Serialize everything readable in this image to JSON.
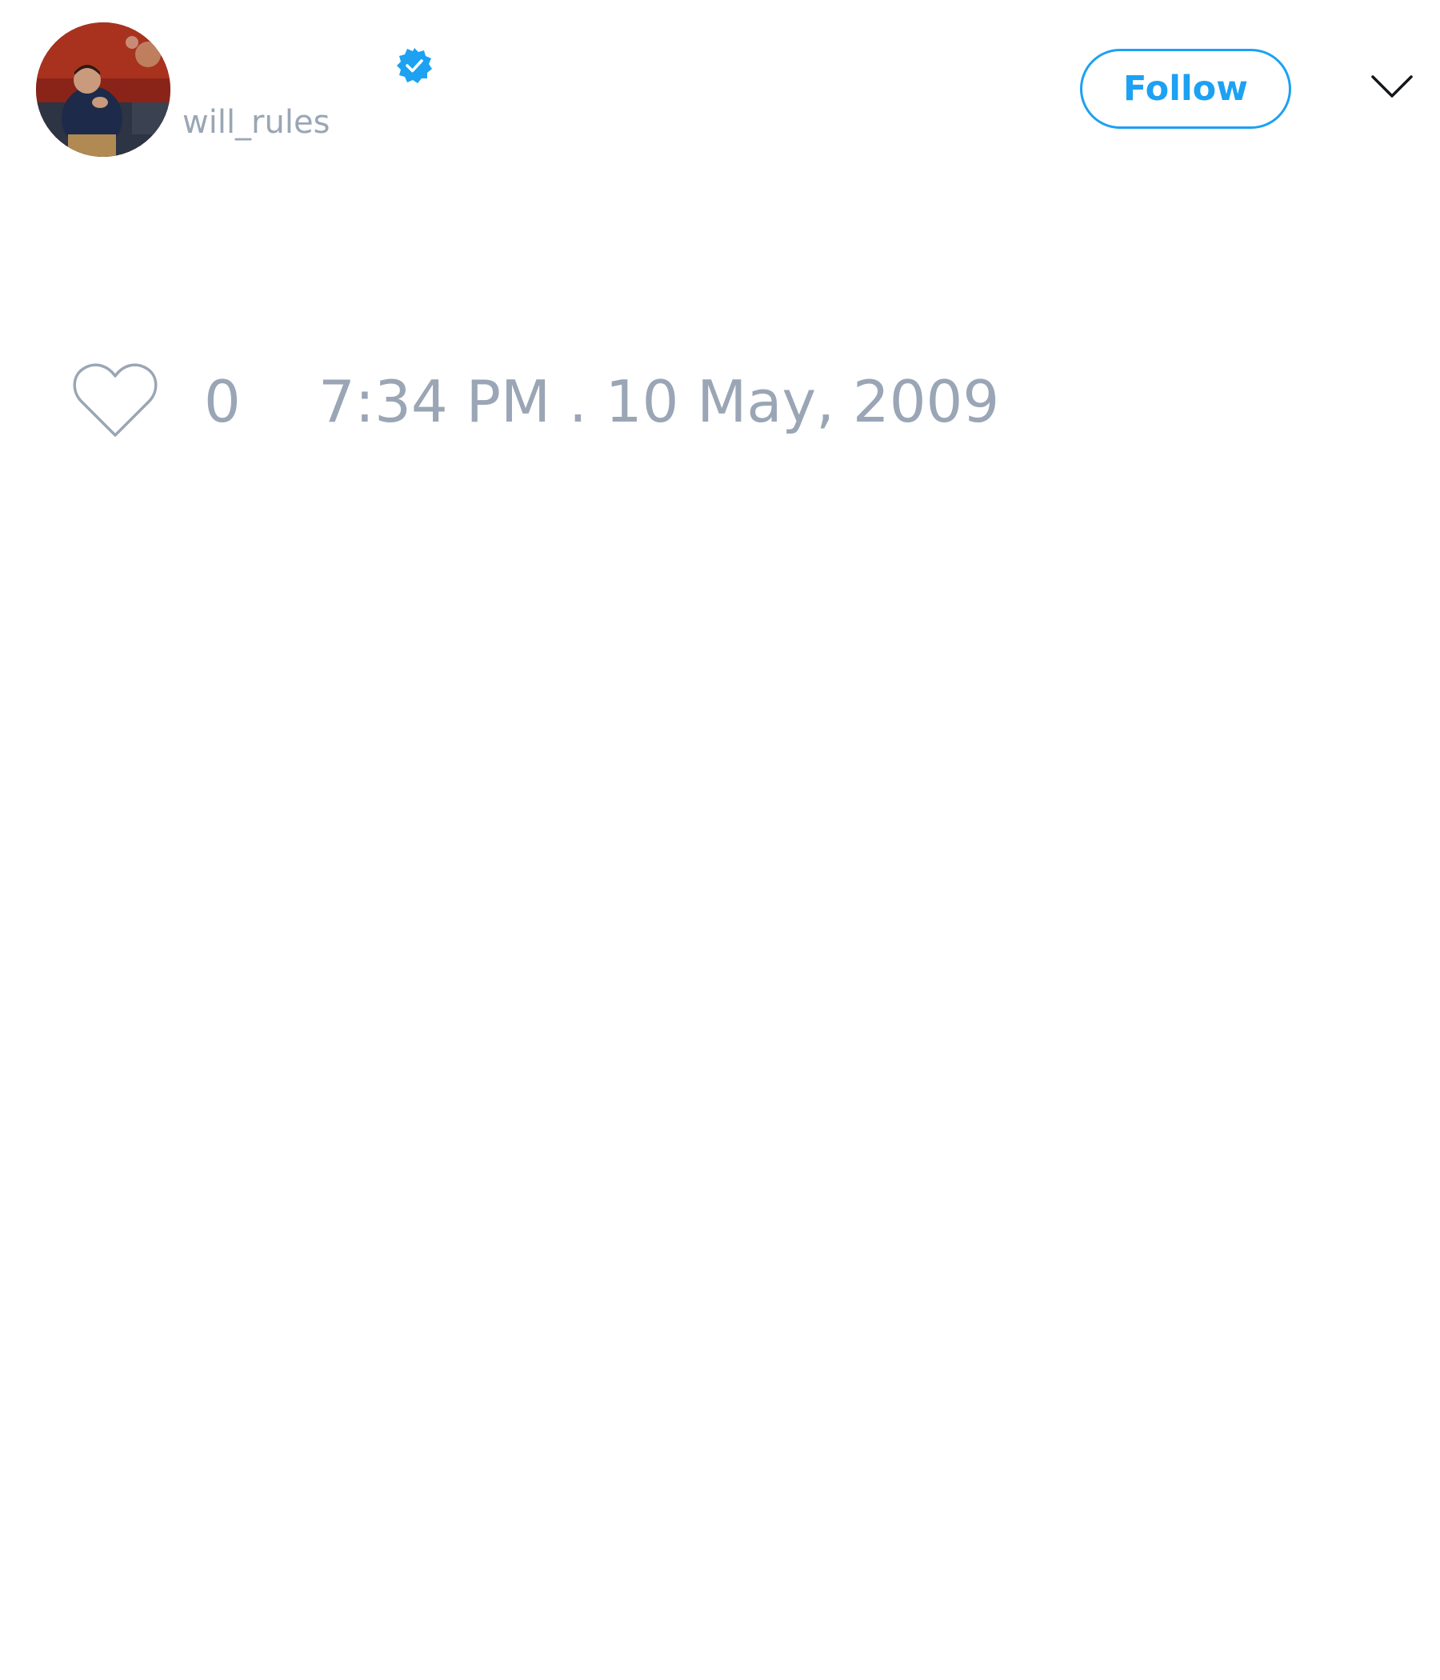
{
  "tweet": {
    "author": {
      "display_name": "",
      "handle": "will_rules",
      "verified": true,
      "avatar_icon": "profile-photo"
    },
    "follow_button": {
      "label": "Follow",
      "color": "#1da1f2"
    },
    "menu_icon": "chevron-down-icon",
    "likes": {
      "icon": "heart-icon",
      "count": "0"
    },
    "timestamp": "7:34 PM . 10 May, 2009"
  },
  "colors": {
    "accent": "#1da1f2",
    "muted_text": "#9aa6b5",
    "background": "#ffffff"
  }
}
